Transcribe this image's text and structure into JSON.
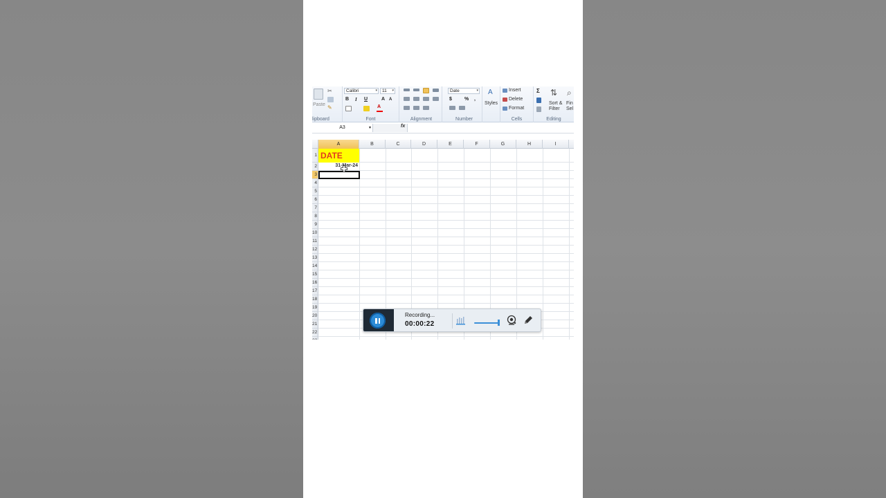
{
  "ribbon": {
    "clipboard": {
      "label": "lipboard",
      "paste": "Paste"
    },
    "font": {
      "label": "Font",
      "font_name": "Calibri",
      "font_size": "11",
      "bold": "B",
      "italic": "I",
      "underline": "U"
    },
    "alignment": {
      "label": "Alignment"
    },
    "number": {
      "label": "Number",
      "format": "Date",
      "currency": "$",
      "percent": "%"
    },
    "styles": {
      "label": "Styles"
    },
    "cells": {
      "label": "Cells",
      "insert": "Insert",
      "delete": "Delete",
      "format": "Format"
    },
    "editing": {
      "label": "Editing",
      "sort_filter_1": "Sort &",
      "sort_filter_2": "Filter",
      "find_1": "Fin",
      "find_2": "Sel"
    }
  },
  "formula_bar": {
    "name_box": "A3",
    "fx": "fx"
  },
  "grid": {
    "columns": [
      "A",
      "B",
      "C",
      "D",
      "E",
      "F",
      "G",
      "H",
      "I"
    ],
    "rows": [
      "1",
      "2",
      "3",
      "4",
      "5",
      "6",
      "7",
      "8",
      "9",
      "10",
      "11",
      "12",
      "13",
      "14",
      "15",
      "16",
      "17",
      "18",
      "19",
      "20",
      "21",
      "22",
      "23"
    ],
    "cells": {
      "A1": "DATE",
      "A2": "31-Mar-24"
    },
    "selected_cell": "A3"
  },
  "recorder": {
    "status": "Recording...",
    "time": "00:00:22"
  },
  "colors": {
    "header_fill": "#ffff00",
    "header_text": "#e13b1f",
    "selection_header": "#f3c96a",
    "recorder_accent": "#2c8bd6"
  }
}
